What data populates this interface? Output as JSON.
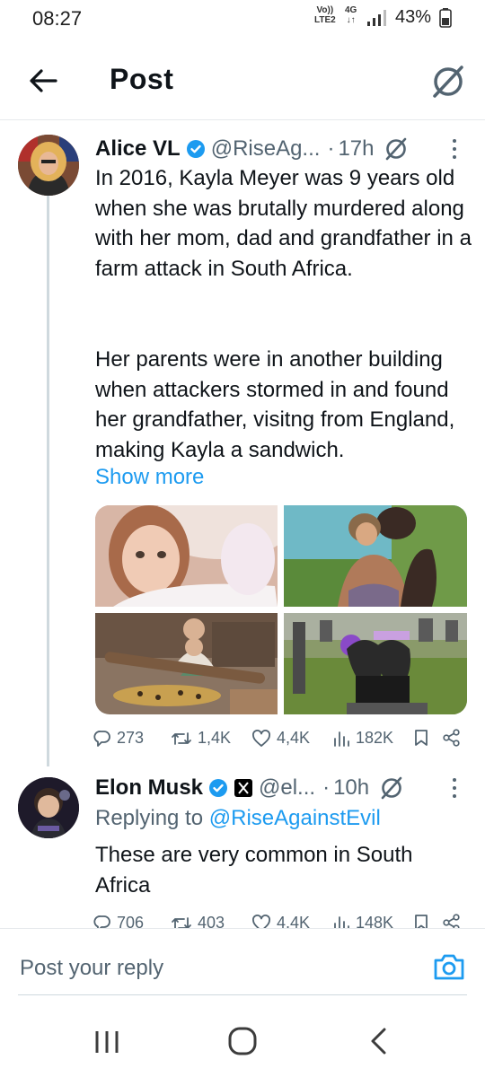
{
  "status_bar": {
    "time": "08:27",
    "net_line1": "Vo))",
    "net_line2": "LTE2",
    "gen_line1": "4G",
    "gen_line2": "↓↑",
    "battery": "43%"
  },
  "header": {
    "title": "Post"
  },
  "post": {
    "display_name": "Alice VL",
    "handle": "@RiseAg...",
    "separator": "·",
    "time": "17h",
    "text_para1": "In 2016, Kayla Meyer was 9 years old when she was brutally murdered along with her mom, dad and grandfather in a farm attack in South Africa.",
    "text_para2": "Her parents were in another building when attackers stormed in and found her grandfather, visitng from England, making Kayla a sandwich.",
    "show_more": "Show more",
    "stats": {
      "replies": "273",
      "reposts": "1,4K",
      "likes": "4,4K",
      "views": "182K"
    }
  },
  "reply": {
    "display_name": "Elon Musk",
    "handle": "@el...",
    "separator": "·",
    "time": "10h",
    "replying_prefix": "Replying to",
    "replying_mention": "@RiseAgainstEvil",
    "text": "These are very common in South Africa",
    "stats": {
      "replies": "706",
      "reposts": "403",
      "likes": "4,4K",
      "views": "148K"
    }
  },
  "compose": {
    "placeholder": "Post your reply"
  },
  "icons": {
    "back": "arrow-left-icon",
    "grok": "grok-icon",
    "verified": "verified-badge-icon",
    "reply": "reply-icon",
    "repost": "repost-icon",
    "like": "heart-icon",
    "views": "views-icon",
    "bookmark": "bookmark-icon",
    "share": "share-icon",
    "camera": "camera-icon"
  },
  "colors": {
    "accent": "#1d9bf0",
    "secondary_text": "#536471",
    "primary_text": "#0f1419"
  }
}
